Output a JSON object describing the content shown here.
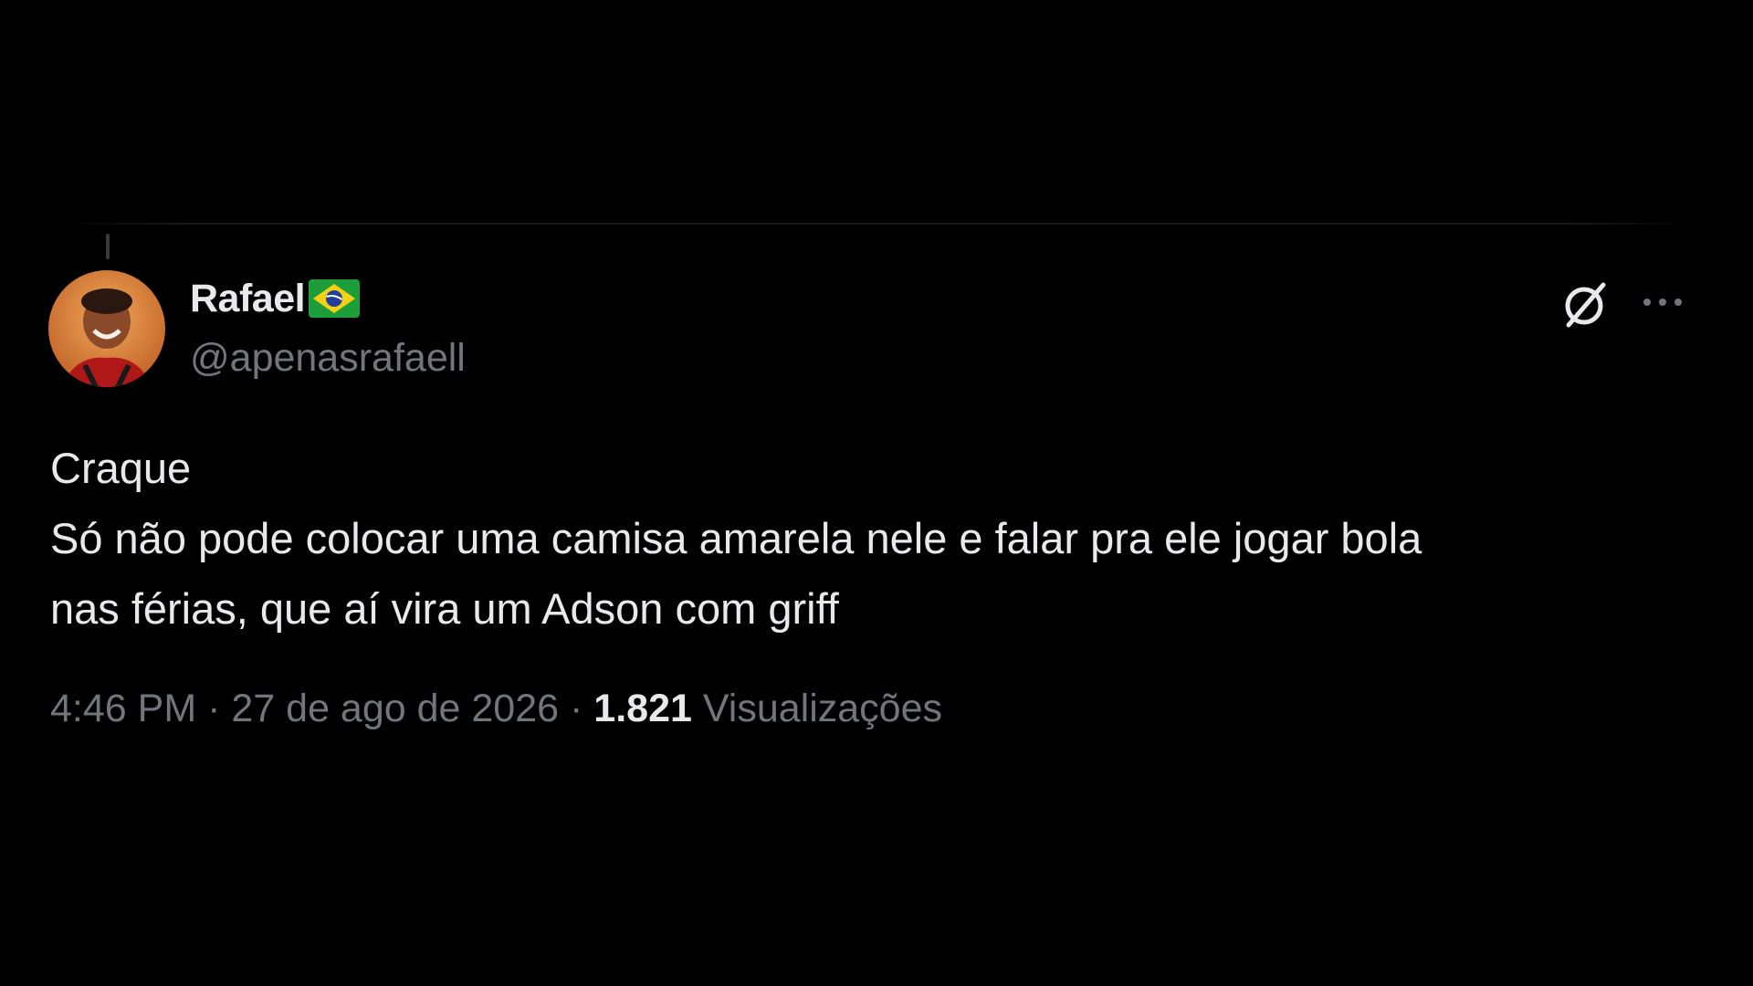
{
  "author": {
    "display_name": "Rafael",
    "flag_icon": "brazil-flag-icon",
    "handle": "@apenasrafaell"
  },
  "tweet": {
    "lines": [
      "Craque",
      "Só não pode colocar uma camisa amarela nele e falar pra ele jogar bola",
      "nas férias, que aí vira um Adson com griff"
    ]
  },
  "meta": {
    "time": "4:46 PM",
    "separator": "·",
    "date": "27 de ago de 2026",
    "views_count": "1.821",
    "views_label": "Visualizações"
  },
  "icons": {
    "grok": "grok-icon",
    "more": "more-options-icon"
  },
  "colors": {
    "background": "#000000",
    "text_primary": "#e7e9ea",
    "text_secondary": "#71767b"
  }
}
